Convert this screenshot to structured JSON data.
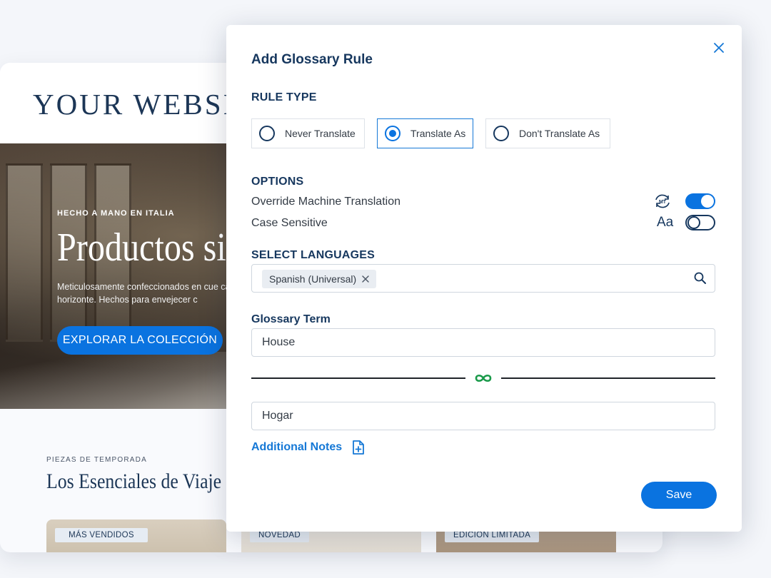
{
  "website": {
    "logo": "YOUR WEBSITE",
    "hero": {
      "eyebrow": "HECHO A MANO EN ITALIA",
      "title": "Productos si",
      "description": "Meticulosamente confeccionados en cue cada horizonte. Hechos para envejecer c",
      "cta": "EXPLORAR LA COLECCIÓN"
    },
    "section": {
      "eyebrow": "PIEZAS DE TEMPORADA",
      "title": "Los Esenciales de Viaje"
    },
    "products": [
      {
        "badge": "MÁS VENDIDOS"
      },
      {
        "badge": "NOVEDAD"
      },
      {
        "badge": "EDICION LIMITADA"
      }
    ]
  },
  "modal": {
    "title": "Add Glossary Rule",
    "close_icon": "close-icon",
    "rule_type": {
      "label": "RULE TYPE",
      "options": [
        {
          "label": "Never Translate",
          "selected": false
        },
        {
          "label": "Translate As",
          "selected": true
        },
        {
          "label": "Don't Translate As",
          "selected": false
        }
      ]
    },
    "options": {
      "label": "OPTIONS",
      "override": {
        "label": "Override Machine Translation",
        "icon_text": "MT",
        "enabled": true
      },
      "case_sensitive": {
        "label": "Case Sensitive",
        "icon_text": "Aa",
        "enabled": false
      }
    },
    "languages": {
      "label": "SELECT LANGUAGES",
      "selected": [
        "Spanish (Universal)"
      ]
    },
    "glossary_term": {
      "label": "Glossary Term",
      "value": "House"
    },
    "translation": {
      "value": "Hogar"
    },
    "additional_notes": "Additional Notes",
    "save": "Save"
  },
  "colors": {
    "brand_blue": "#0a73e0",
    "heading_navy": "#16375e",
    "link_icon_green": "#1a9a4a"
  }
}
